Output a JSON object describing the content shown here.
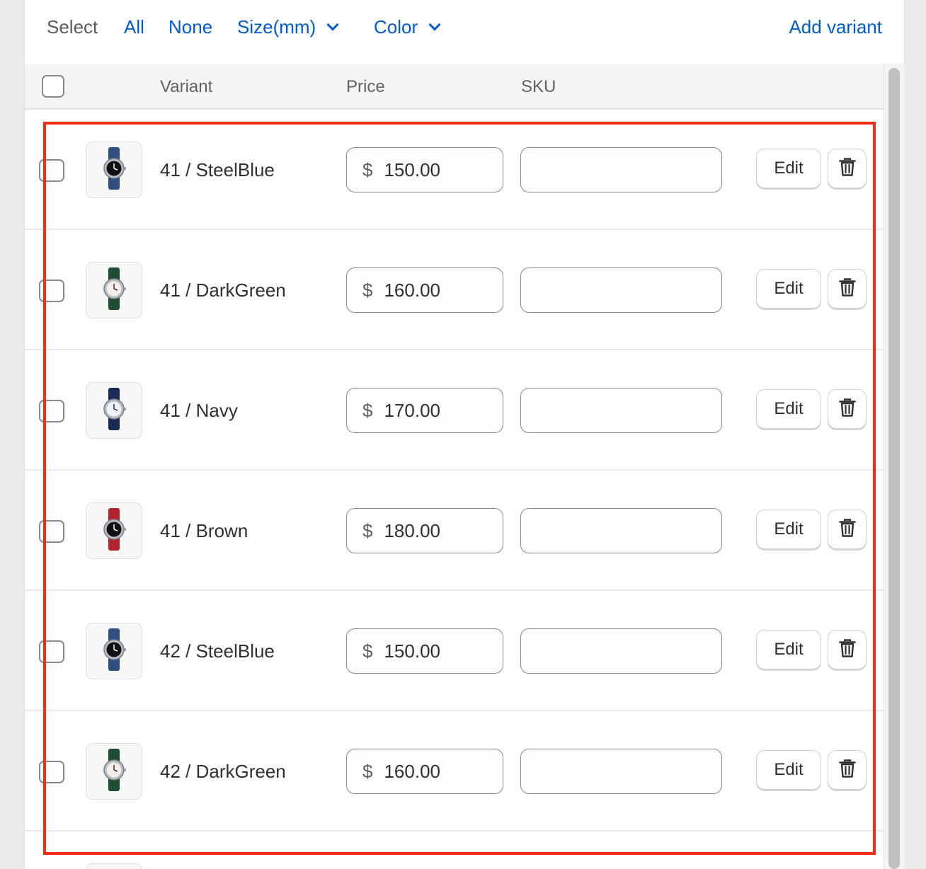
{
  "toolbar": {
    "select_label": "Select",
    "all_label": "All",
    "none_label": "None",
    "size_label": "Size(mm)",
    "color_label": "Color",
    "add_variant_label": "Add variant"
  },
  "table": {
    "columns": [
      "Variant",
      "Price",
      "SKU"
    ],
    "edit_label": "Edit",
    "currency_symbol": "$"
  },
  "variants": [
    {
      "name": "41 / SteelBlue",
      "price": "150.00",
      "sku": "",
      "strap_color": "#2f4f7f",
      "face_color": "#111111"
    },
    {
      "name": "41 / DarkGreen",
      "price": "160.00",
      "sku": "",
      "strap_color": "#1f4d34",
      "face_color": "#f4efe8"
    },
    {
      "name": "41 / Navy",
      "price": "170.00",
      "sku": "",
      "strap_color": "#1b2a55",
      "face_color": "#eef2fb"
    },
    {
      "name": "41 / Brown",
      "price": "180.00",
      "sku": "",
      "strap_color": "#b3232b",
      "face_color": "#111111"
    },
    {
      "name": "42 / SteelBlue",
      "price": "150.00",
      "sku": "",
      "strap_color": "#2f4f7f",
      "face_color": "#111111"
    },
    {
      "name": "42 / DarkGreen",
      "price": "160.00",
      "sku": "",
      "strap_color": "#1f4d34",
      "face_color": "#f4efe8"
    }
  ],
  "colors": {
    "link": "#005bd3",
    "highlight": "#f22b14"
  }
}
